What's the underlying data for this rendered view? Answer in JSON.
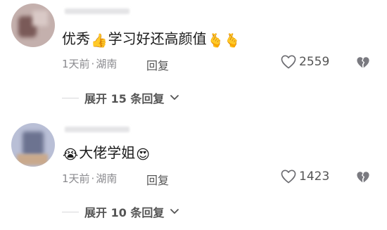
{
  "comments": [
    {
      "text_before": "优秀",
      "text_after": "学习好还高颜值",
      "time": "1天前",
      "location": "湖南",
      "reply_label": "回复",
      "likes": "2559",
      "expand_label": "展开 15 条回复",
      "emoji_after_1": "👍",
      "emoji_end": "🫰🫰"
    },
    {
      "emoji_start": "😭",
      "text": "大佬学姐",
      "emoji_end": "😍",
      "time": "1天前",
      "location": "湖南",
      "reply_label": "回复",
      "likes": "1423",
      "expand_label": "展开 10 条回复"
    }
  ],
  "meta_separator": "·"
}
